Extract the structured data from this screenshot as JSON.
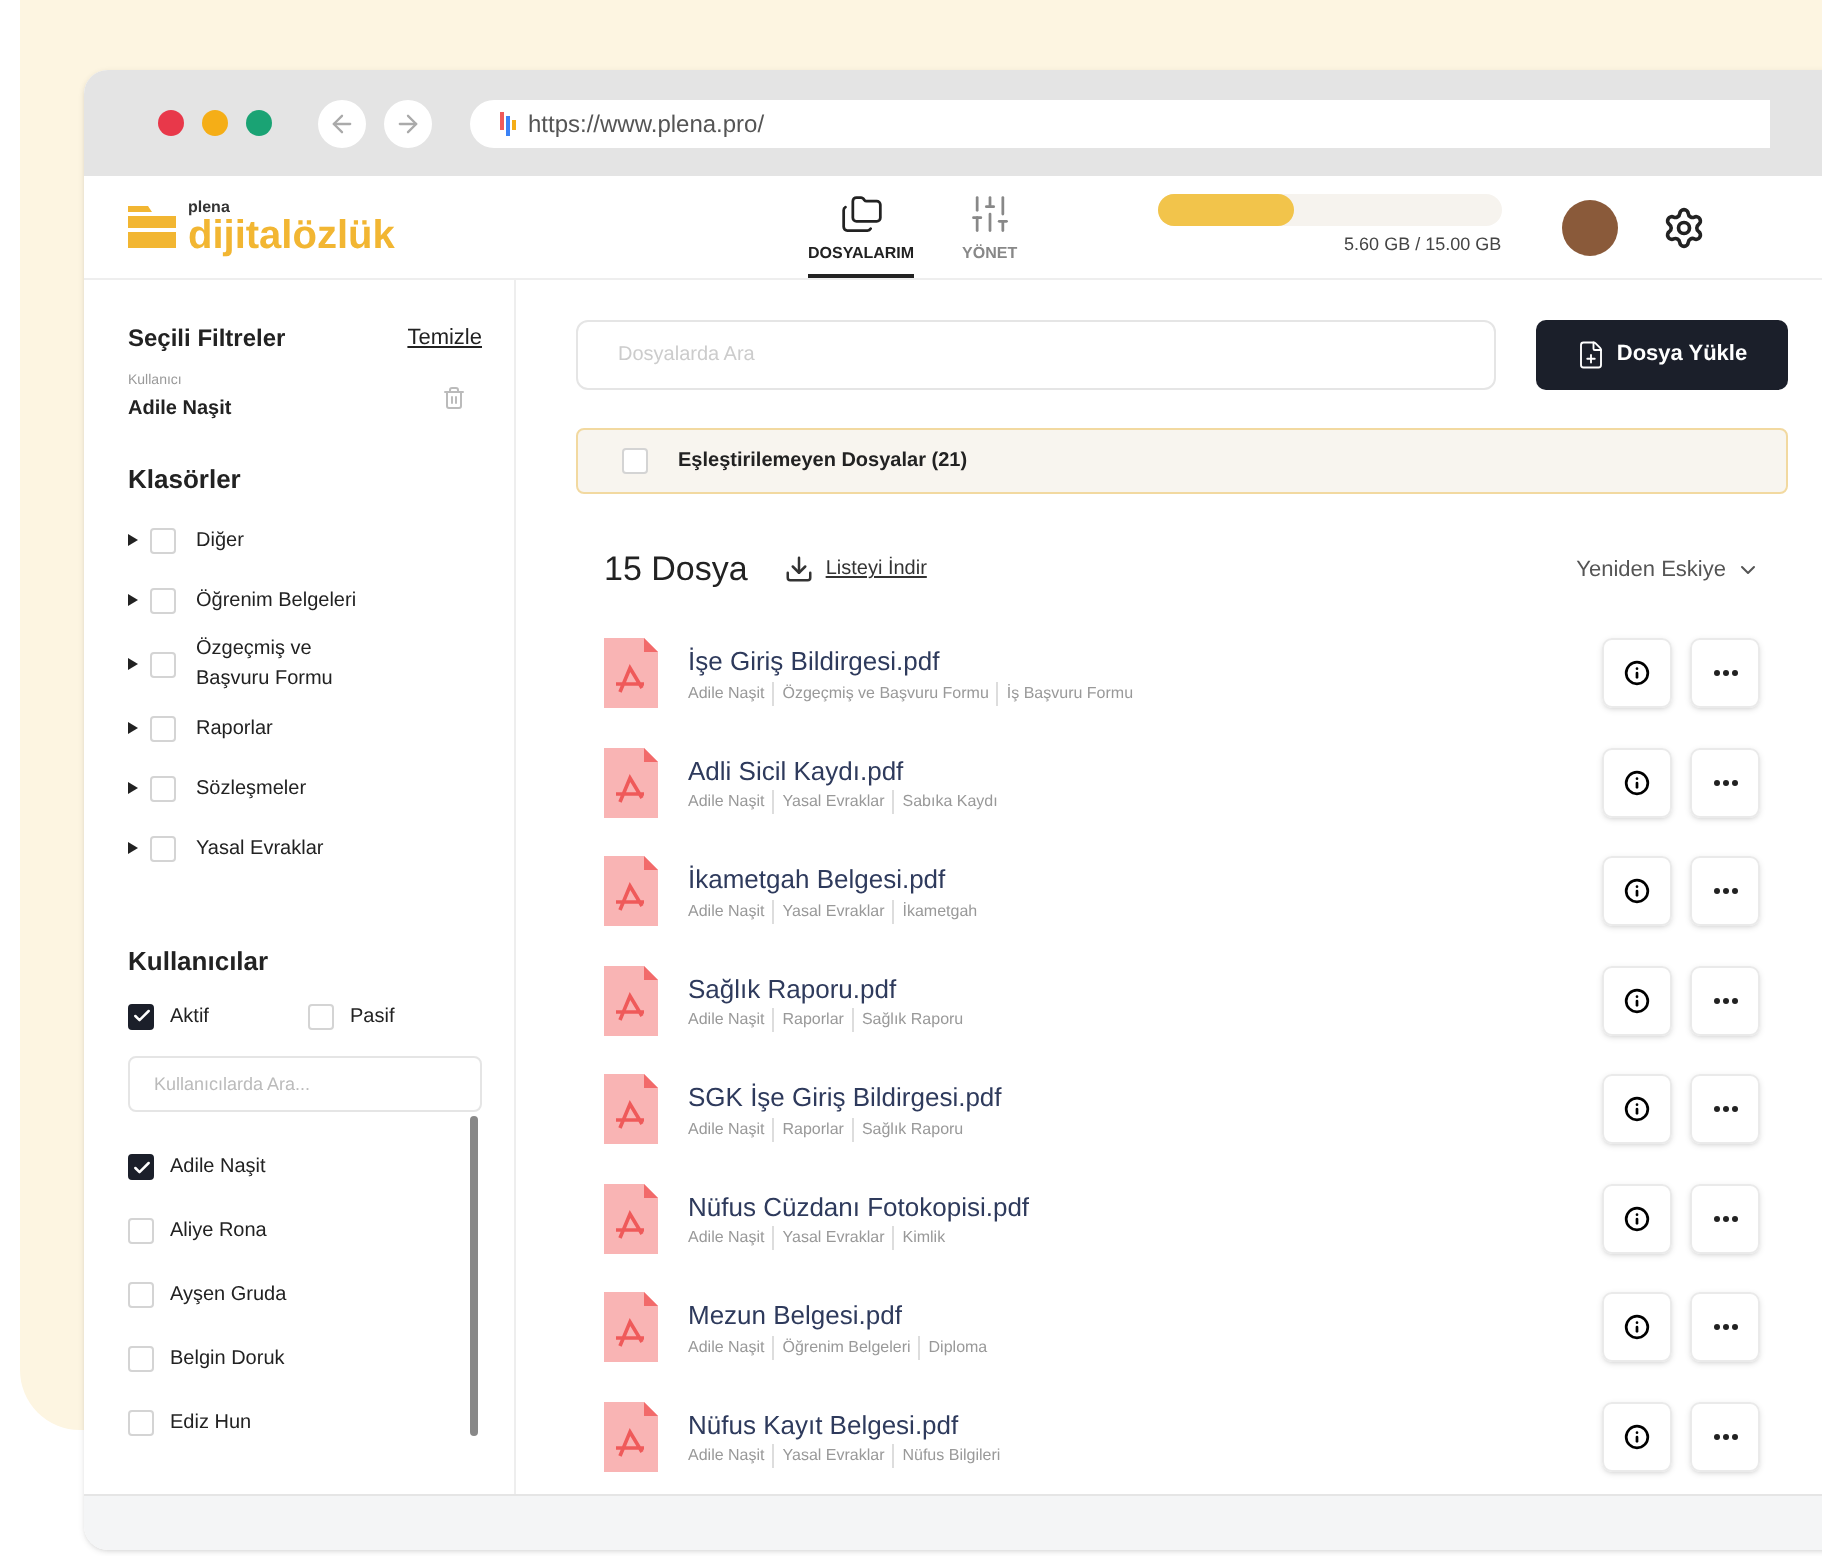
{
  "browser": {
    "url": "https://www.plena.pro/"
  },
  "header": {
    "logo_small": "plena",
    "logo": "dijitalözlük",
    "nav": [
      {
        "label": "DOSYALARIM",
        "kind": "folders",
        "selected": true
      },
      {
        "label": "YÖNET",
        "kind": "sliders",
        "selected": false
      }
    ],
    "storage": {
      "level": 0.4,
      "reading": "5.60 GB / 15.00 GB"
    }
  },
  "sidebar": {
    "title": "Seçili Filtreler",
    "clear": "Temizle",
    "filter": {
      "label": "Kullanıcı",
      "value": "Adile Naşit"
    },
    "folders_title": "Klasörler",
    "folders": [
      {
        "label": "Diğer",
        "checked": false
      },
      {
        "label": "Öğrenim Belgeleri",
        "checked": false
      },
      {
        "label": "Özgeçmiş ve Başvuru Formu",
        "checked": false
      },
      {
        "label": "Raporlar",
        "checked": false
      },
      {
        "label": "Sözleşmeler",
        "checked": false
      },
      {
        "label": "Yasal Evraklar",
        "checked": false
      }
    ],
    "users_title": "Kullanıcılar",
    "status": [
      {
        "label": "Aktif",
        "checked": true
      },
      {
        "label": "Pasif",
        "checked": false
      }
    ],
    "user_search": {
      "placeholder": "Kullanıcılarda Ara..."
    },
    "users": [
      {
        "label": "Adile Naşit",
        "checked": true
      },
      {
        "label": "Aliye Rona",
        "checked": false
      },
      {
        "label": "Ayşen Gruda",
        "checked": false
      },
      {
        "label": "Belgin Doruk",
        "checked": false
      },
      {
        "label": "Ediz Hun",
        "checked": false
      }
    ]
  },
  "main": {
    "search": {
      "placeholder": "Dosyalarda Ara"
    },
    "upload": "Dosya Yükle",
    "unmatched": {
      "label": "Eşleştirilemeyen Dosyalar (21)",
      "checked": false
    },
    "count": "15 Dosya",
    "download": "Listeyi İndir",
    "sort": "Yeniden Eskiye",
    "files": [
      {
        "name": "İşe Giriş Bildirgesi.pdf",
        "tags": [
          "Adile Naşit",
          "Özgeçmiş ve Başvuru Formu",
          "İş Başvuru Formu"
        ]
      },
      {
        "name": "Adli Sicil Kaydı.pdf",
        "tags": [
          "Adile Naşit",
          "Yasal Evraklar",
          "Sabıka Kaydı"
        ]
      },
      {
        "name": "İkametgah Belgesi.pdf",
        "tags": [
          "Adile Naşit",
          "Yasal Evraklar",
          "İkametgah"
        ]
      },
      {
        "name": "Sağlık Raporu.pdf",
        "tags": [
          "Adile Naşit",
          "Raporlar",
          "Sağlık Raporu"
        ]
      },
      {
        "name": "SGK İşe Giriş Bildirgesi.pdf",
        "tags": [
          "Adile Naşit",
          "Raporlar",
          "Sağlık Raporu"
        ]
      },
      {
        "name": "Nüfus Cüzdanı Fotokopisi.pdf",
        "tags": [
          "Adile Naşit",
          "Yasal Evraklar",
          "Kimlik"
        ]
      },
      {
        "name": "Mezun Belgesi.pdf",
        "tags": [
          "Adile Naşit",
          "Öğrenim Belgeleri",
          "Diploma"
        ]
      },
      {
        "name": "Nüfus Kayıt Belgesi.pdf",
        "tags": [
          "Adile Naşit",
          "Yasal Evraklar",
          "Nüfus Bilgileri"
        ]
      }
    ]
  }
}
